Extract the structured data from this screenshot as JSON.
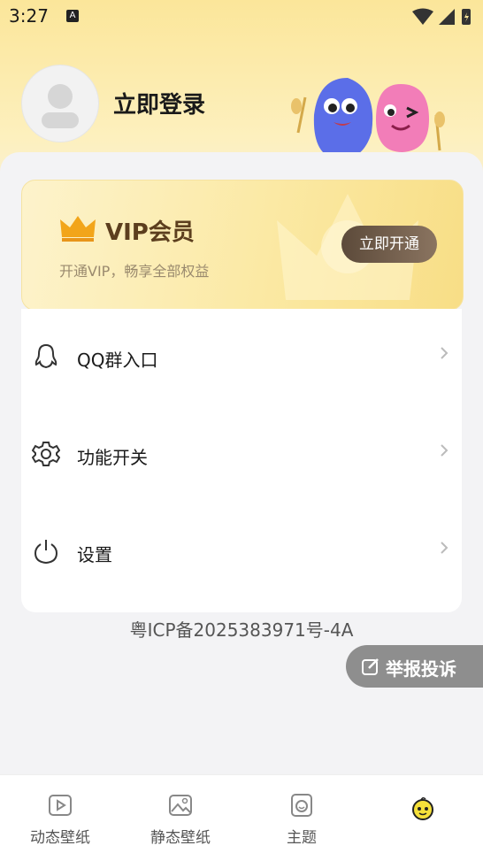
{
  "status_bar": {
    "time": "3:27",
    "notification_letter": "A"
  },
  "profile": {
    "login_label": "立即登录"
  },
  "vip": {
    "title": "VIP会员",
    "subtitle": "开通VIP，畅享全部权益",
    "button_label": "立即开通"
  },
  "menu": {
    "items": [
      {
        "label": "QQ群入口",
        "icon": "qq-icon"
      },
      {
        "label": "功能开关",
        "icon": "gear-icon"
      },
      {
        "label": "设置",
        "icon": "power-icon"
      }
    ]
  },
  "footer": {
    "icp": "粤ICP备2025383971号-4A"
  },
  "report": {
    "label": "举报投诉"
  },
  "tabbar": {
    "tabs": [
      {
        "label": "动态壁纸",
        "icon": "video-wallpaper-icon"
      },
      {
        "label": "静态壁纸",
        "icon": "image-wallpaper-icon"
      },
      {
        "label": "主题",
        "icon": "theme-icon"
      },
      {
        "label": "",
        "icon": "mascot-profile-icon"
      }
    ]
  },
  "colors": {
    "accent": "#fbe69a",
    "vip_button": "#6b5848",
    "report_bg": "#8e8e8e"
  }
}
